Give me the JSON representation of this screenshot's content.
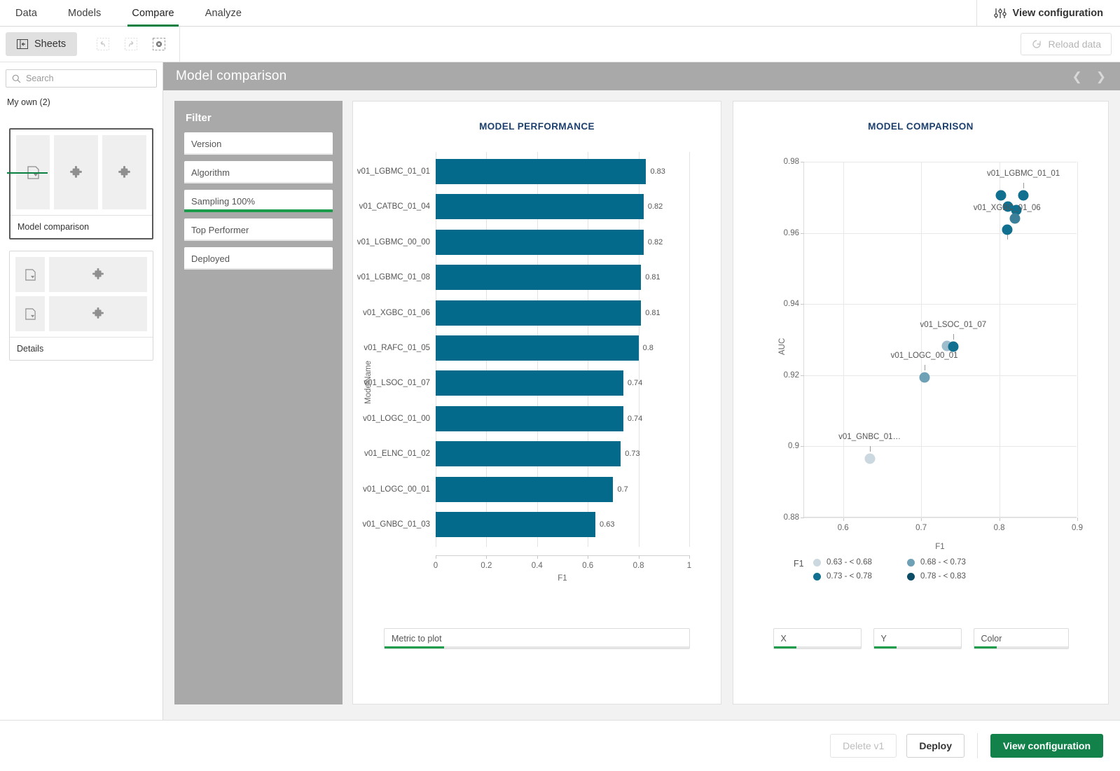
{
  "topnav": {
    "tabs": [
      {
        "label": "Data",
        "active": false
      },
      {
        "label": "Models",
        "active": false
      },
      {
        "label": "Compare",
        "active": true
      },
      {
        "label": "Analyze",
        "active": false
      }
    ],
    "view_configuration": "View configuration"
  },
  "toolbar": {
    "sheets_label": "Sheets",
    "undo_icon": "undo-icon",
    "redo_icon": "redo-icon",
    "clear_selections_icon": "clear-selections-icon",
    "reload_label": "Reload data"
  },
  "sidebar": {
    "search_placeholder": "Search",
    "tab_label": "My own (2)",
    "sheets": [
      {
        "label": "Model comparison",
        "selected": true
      },
      {
        "label": "Details",
        "selected": false
      }
    ]
  },
  "sheet": {
    "title": "Model comparison",
    "prev_icon": "chevron-left-icon",
    "next_icon": "chevron-right-icon"
  },
  "filter": {
    "title": "Filter",
    "items": [
      {
        "label": "Version",
        "selected": false
      },
      {
        "label": "Algorithm",
        "selected": false
      },
      {
        "label": "Sampling 100%",
        "selected": true
      },
      {
        "label": "Top Performer",
        "selected": false
      },
      {
        "label": "Deployed",
        "selected": false
      }
    ]
  },
  "controls": {
    "metric_to_plot": "Metric to plot",
    "x": "X",
    "y": "Y",
    "color": "Color"
  },
  "footer": {
    "delete_label": "Delete v1",
    "deploy_label": "Deploy",
    "view_configuration_label": "View configuration"
  },
  "colors": {
    "bar": "#046a8c",
    "accent_green": "#12824a",
    "title_blue": "#1c3f6e",
    "panel_gray": "#a9a9a9"
  },
  "chart_data": [
    {
      "type": "bar",
      "title": "MODEL PERFORMANCE",
      "orientation": "horizontal",
      "xlabel": "F1",
      "ylabel": "ModelName",
      "xlim": [
        0,
        1
      ],
      "xticks": [
        0,
        0.2,
        0.4,
        0.6,
        0.8,
        1
      ],
      "grid": true,
      "categories": [
        "v01_LGBMC_01_01",
        "v01_CATBC_01_04",
        "v01_LGBMC_00_00",
        "v01_LGBMC_01_08",
        "v01_XGBC_01_06",
        "v01_RAFC_01_05",
        "v01_LSOC_01_07",
        "v01_LOGC_01_00",
        "v01_ELNC_01_02",
        "v01_LOGC_00_01",
        "v01_GNBC_01_03"
      ],
      "values": [
        0.83,
        0.82,
        0.82,
        0.81,
        0.81,
        0.8,
        0.74,
        0.74,
        0.73,
        0.7,
        0.63
      ],
      "value_labels": [
        "0.83",
        "0.82",
        "0.82",
        "0.81",
        "0.81",
        "0.8",
        "0.74",
        "0.74",
        "0.73",
        "0.7",
        "0.63"
      ]
    },
    {
      "type": "scatter",
      "title": "MODEL COMPARISON",
      "xlabel": "F1",
      "ylabel": "AUC",
      "xlim": [
        0.55,
        0.9
      ],
      "ylim": [
        0.88,
        0.98
      ],
      "xticks": [
        0.6,
        0.7,
        0.8,
        0.9
      ],
      "yticks": [
        0.88,
        0.9,
        0.92,
        0.94,
        0.96,
        0.98
      ],
      "grid": true,
      "points": [
        {
          "x": 0.802,
          "y": 0.9705,
          "label": null,
          "color": "#116f8f"
        },
        {
          "x": 0.831,
          "y": 0.9705,
          "label": "v01_LGBMC_01_01",
          "color": "#116f8f"
        },
        {
          "x": 0.811,
          "y": 0.9675,
          "label": null,
          "color": "#116f8f"
        },
        {
          "x": 0.822,
          "y": 0.9665,
          "label": null,
          "color": "#116f8f"
        },
        {
          "x": 0.82,
          "y": 0.964,
          "label": null,
          "color": "#3b7f99"
        },
        {
          "x": 0.81,
          "y": 0.961,
          "label": "v01_XGBC_01_06",
          "color": "#116f8f"
        },
        {
          "x": 0.733,
          "y": 0.9283,
          "label": null,
          "color": "#9dbdcd"
        },
        {
          "x": 0.741,
          "y": 0.9281,
          "label": "v01_LSOC_01_07",
          "color": "#116f8f"
        },
        {
          "x": 0.704,
          "y": 0.9193,
          "label": "v01_LOGC_00_01",
          "color": "#6ea0b6"
        },
        {
          "x": 0.634,
          "y": 0.8965,
          "label": "v01_GNBC_01…",
          "color": "#cbd8df"
        }
      ],
      "legend": {
        "title": "F1",
        "position": "bottom",
        "entries": [
          {
            "label": "0.63 - < 0.68",
            "color": "#cbd8df"
          },
          {
            "label": "0.68 - < 0.73",
            "color": "#6ea0b6"
          },
          {
            "label": "0.73 - < 0.78",
            "color": "#116f8f"
          },
          {
            "label": "0.78 - < 0.83",
            "color": "#0b4c66"
          }
        ]
      }
    }
  ]
}
